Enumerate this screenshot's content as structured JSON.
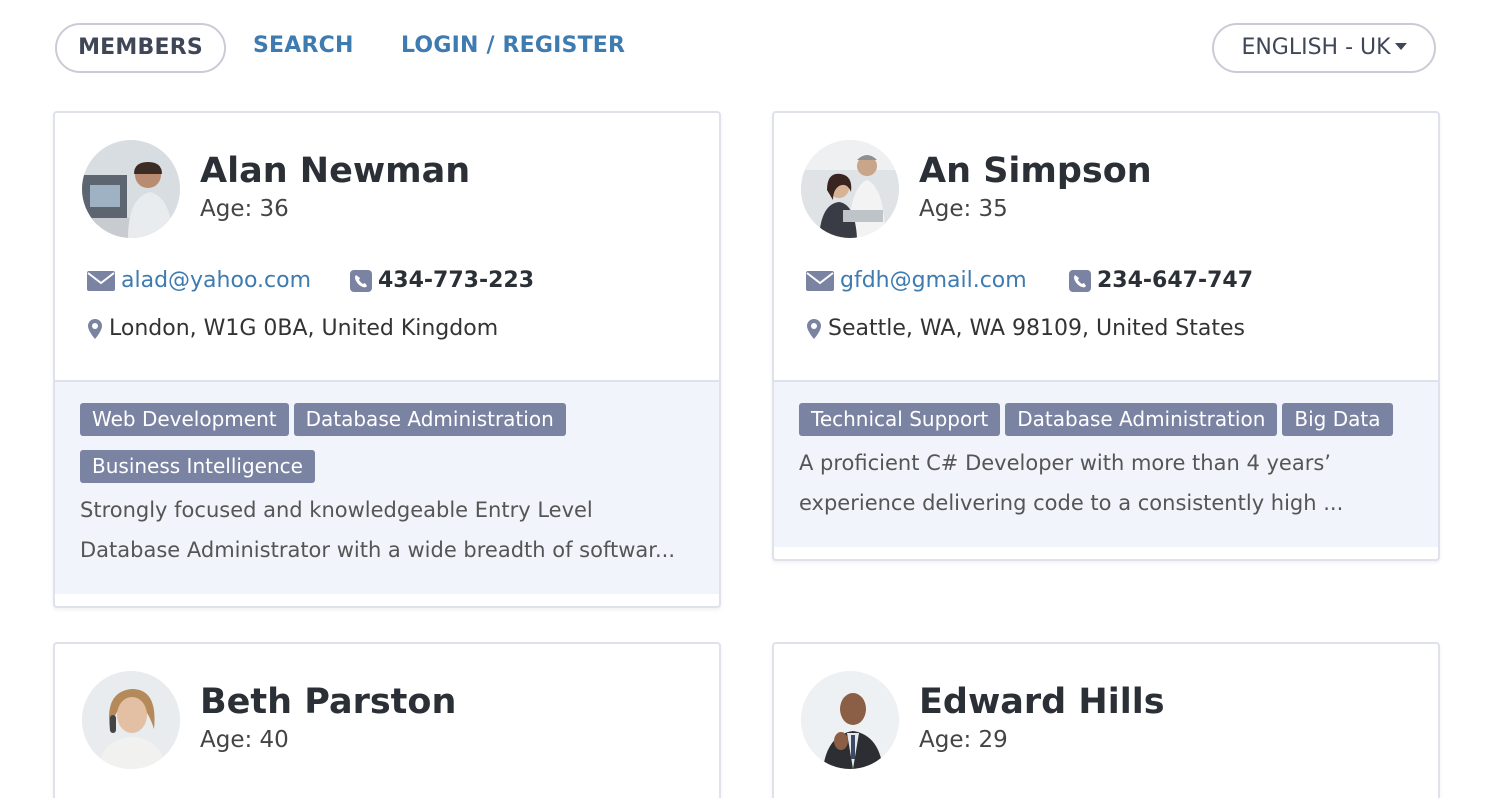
{
  "nav": {
    "members": "MEMBERS",
    "search": "SEARCH",
    "login": "LOGIN / REGISTER",
    "language": "ENGLISH - UK"
  },
  "colors": {
    "link": "#3e7bb0",
    "tag_bg": "#7b83a3",
    "card_bottom_bg": "#f1f4fa"
  },
  "members": [
    {
      "name": "Alan Newman",
      "age": "Age: 36",
      "email": "alad@yahoo.com",
      "phone": "434-773-223",
      "location": "London, W1G 0BA, United Kingdom",
      "tags": [
        "Web Development",
        "Database Administration",
        "Business Intelligence"
      ],
      "description": "Strongly focused and knowledgeable Entry Level Database Administrator with a wide breadth of softwar..."
    },
    {
      "name": "An Simpson",
      "age": "Age: 35",
      "email": "gfdh@gmail.com",
      "phone": "234-647-747",
      "location": "Seattle, WA, WA 98109, United States",
      "tags": [
        "Technical Support",
        "Database Administration",
        "Big Data"
      ],
      "description": "A proficient C# Developer with more than 4 years’ experience delivering code to a consistently high ..."
    },
    {
      "name": "Beth Parston",
      "age": "Age: 40"
    },
    {
      "name": "Edward Hills",
      "age": "Age: 29"
    }
  ]
}
